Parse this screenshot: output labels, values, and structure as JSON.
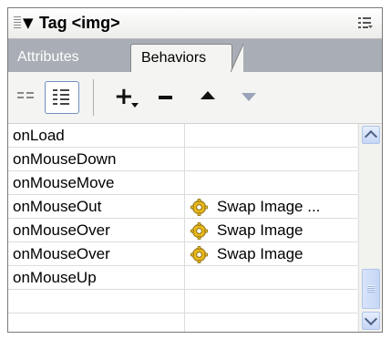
{
  "panel": {
    "title": "Tag <img>",
    "collapse_glyph": "▼",
    "icons": [
      "grip-icon",
      "collapse-triangle-icon",
      "panel-options-icon"
    ]
  },
  "tabs": [
    {
      "label": "Attributes",
      "active": false
    },
    {
      "label": "Behaviors",
      "active": true
    }
  ],
  "toolbar": {
    "add_glyph": "+",
    "icons": [
      "show-set-events-icon",
      "show-all-events-icon",
      "add-behavior-icon",
      "remove-behavior-icon",
      "move-up-icon",
      "move-down-icon"
    ]
  },
  "events": [
    {
      "event": "onLoad",
      "action": ""
    },
    {
      "event": "onMouseDown",
      "action": ""
    },
    {
      "event": "onMouseMove",
      "action": ""
    },
    {
      "event": "onMouseOut",
      "action": "Swap Image ..."
    },
    {
      "event": "onMouseOver",
      "action": "Swap Image"
    },
    {
      "event": "onMouseOver",
      "action": "Swap Image"
    },
    {
      "event": "onMouseUp",
      "action": ""
    },
    {
      "event": "",
      "action": ""
    }
  ],
  "colors": {
    "tabs_bar": "#a9aeb6",
    "panel_bg": "#f4f4f2",
    "scroll_accent": "#c6d6f5"
  }
}
